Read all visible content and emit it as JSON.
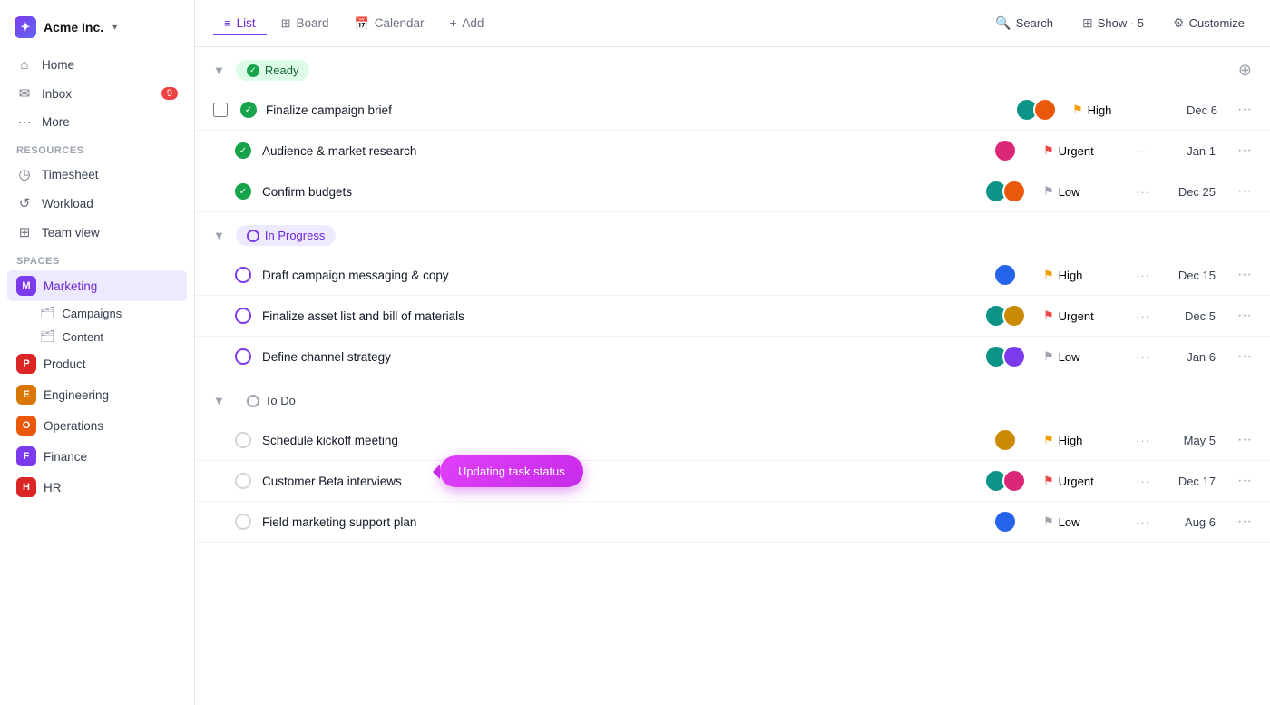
{
  "app": {
    "logo": "✦",
    "company": "Acme Inc.",
    "chevron": "▾"
  },
  "nav": {
    "items": [
      {
        "id": "home",
        "icon": "⌂",
        "label": "Home",
        "badge": null
      },
      {
        "id": "inbox",
        "icon": "✉",
        "label": "Inbox",
        "badge": "9"
      },
      {
        "id": "more",
        "icon": "···",
        "label": "More",
        "badge": null
      }
    ]
  },
  "resources": {
    "label": "Resources",
    "items": [
      {
        "id": "timesheet",
        "icon": "◷",
        "label": "Timesheet"
      },
      {
        "id": "workload",
        "icon": "↺",
        "label": "Workload"
      },
      {
        "id": "teamview",
        "icon": "⊞",
        "label": "Team view"
      }
    ]
  },
  "spaces": {
    "label": "Spaces",
    "items": [
      {
        "id": "marketing",
        "label": "Marketing",
        "color": "#7c3aed",
        "letter": "M",
        "active": true
      },
      {
        "id": "product",
        "label": "Product",
        "color": "#dc2626",
        "letter": "P",
        "active": false
      },
      {
        "id": "engineering",
        "label": "Engineering",
        "color": "#d97706",
        "letter": "E",
        "active": false
      },
      {
        "id": "operations",
        "label": "Operations",
        "color": "#ea580c",
        "letter": "O",
        "active": false
      },
      {
        "id": "finance",
        "label": "Finance",
        "color": "#7c3aed",
        "letter": "F",
        "active": false
      },
      {
        "id": "hr",
        "label": "HR",
        "color": "#dc2626",
        "letter": "H",
        "active": false
      }
    ],
    "sub_items": [
      {
        "id": "campaigns",
        "label": "Campaigns"
      },
      {
        "id": "content",
        "label": "Content"
      }
    ]
  },
  "tabs": [
    {
      "id": "list",
      "icon": "≡",
      "label": "List",
      "active": true
    },
    {
      "id": "board",
      "icon": "⊞",
      "label": "Board",
      "active": false
    },
    {
      "id": "calendar",
      "icon": "📅",
      "label": "Calendar",
      "active": false
    },
    {
      "id": "add",
      "icon": "+",
      "label": "Add",
      "active": false
    }
  ],
  "topnav_right": {
    "search": "Search",
    "show": "Show · 5",
    "customize": "Customize"
  },
  "groups": [
    {
      "id": "ready",
      "label": "Ready",
      "type": "ready",
      "tasks": [
        {
          "id": "t1",
          "name": "Finalize campaign brief",
          "avatars": [
            "teal",
            "orange"
          ],
          "priority": "High",
          "priority_type": "high",
          "date": "Dec 6",
          "has_checkbox": true,
          "status": "done"
        },
        {
          "id": "t2",
          "name": "Audience & market research",
          "avatars": [
            "pink"
          ],
          "priority": "Urgent",
          "priority_type": "urgent",
          "date": "Jan 1",
          "has_checkbox": false,
          "status": "done"
        },
        {
          "id": "t3",
          "name": "Confirm budgets",
          "avatars": [
            "teal",
            "orange"
          ],
          "priority": "Low",
          "priority_type": "low",
          "date": "Dec 25",
          "has_checkbox": false,
          "status": "done"
        }
      ]
    },
    {
      "id": "inprogress",
      "label": "In Progress",
      "type": "inprogress",
      "tasks": [
        {
          "id": "t4",
          "name": "Draft campaign messaging & copy",
          "avatars": [
            "blue"
          ],
          "priority": "High",
          "priority_type": "high",
          "date": "Dec 15",
          "has_checkbox": false,
          "status": "in-progress"
        },
        {
          "id": "t5",
          "name": "Finalize asset list and bill of materials",
          "avatars": [
            "teal",
            "yellow"
          ],
          "priority": "Urgent",
          "priority_type": "urgent",
          "date": "Dec 5",
          "has_checkbox": false,
          "status": "in-progress"
        },
        {
          "id": "t6",
          "name": "Define channel strategy",
          "avatars": [
            "teal",
            "purple"
          ],
          "priority": "Low",
          "priority_type": "low",
          "date": "Jan 6",
          "has_checkbox": false,
          "status": "in-progress",
          "tooltip": true
        }
      ]
    },
    {
      "id": "todo",
      "label": "To Do",
      "type": "todo",
      "tasks": [
        {
          "id": "t7",
          "name": "Schedule kickoff meeting",
          "avatars": [
            "yellow"
          ],
          "priority": "High",
          "priority_type": "high",
          "date": "May 5",
          "has_checkbox": false,
          "status": "empty"
        },
        {
          "id": "t8",
          "name": "Customer Beta interviews",
          "avatars": [
            "teal",
            "pink"
          ],
          "priority": "Urgent",
          "priority_type": "urgent",
          "date": "Dec 17",
          "has_checkbox": false,
          "status": "empty"
        },
        {
          "id": "t9",
          "name": "Field marketing support plan",
          "avatars": [
            "blue"
          ],
          "priority": "Low",
          "priority_type": "low",
          "date": "Aug 6",
          "has_checkbox": false,
          "status": "empty"
        }
      ]
    }
  ],
  "tooltip": {
    "text": "Updating task status"
  },
  "icons": {
    "check": "✓",
    "dots": "•••",
    "plus": "+",
    "collapse": "▼",
    "search": "🔍",
    "show": "⊞",
    "customize": "⚙"
  }
}
